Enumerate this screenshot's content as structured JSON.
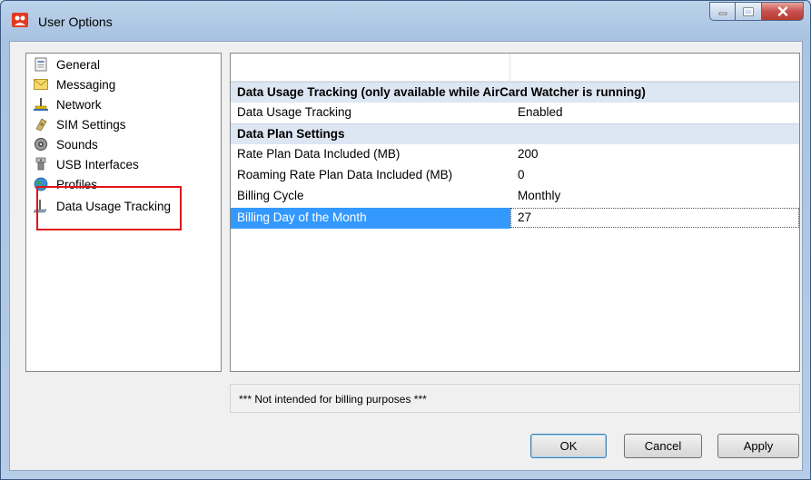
{
  "window": {
    "title": "User Options"
  },
  "nav": {
    "items": [
      {
        "label": "General",
        "icon": "general-icon"
      },
      {
        "label": "Messaging",
        "icon": "envelope-icon"
      },
      {
        "label": "Network",
        "icon": "network-icon"
      },
      {
        "label": "SIM Settings",
        "icon": "sim-card-icon"
      },
      {
        "label": "Sounds",
        "icon": "speaker-icon"
      },
      {
        "label": "USB Interfaces",
        "icon": "usb-icon"
      },
      {
        "label": "Profiles",
        "icon": "globe-icon"
      },
      {
        "label": "Data Usage Tracking",
        "icon": "data-usage-icon"
      }
    ],
    "selected": "Data Usage Tracking"
  },
  "grid": {
    "rows": [
      {
        "type": "category",
        "label": "Data Usage Tracking (only available while AirCard Watcher is running)"
      },
      {
        "type": "property",
        "name": "Data Usage Tracking",
        "value": "Enabled"
      },
      {
        "type": "category",
        "label": "Data Plan Settings"
      },
      {
        "type": "property",
        "name": "Rate Plan Data Included (MB)",
        "value": "200"
      },
      {
        "type": "property",
        "name": "Roaming Rate Plan Data Included (MB)",
        "value": "0"
      },
      {
        "type": "property",
        "name": "Billing Cycle",
        "value": "Monthly"
      },
      {
        "type": "property",
        "name": "Billing Day of the Month",
        "value": "27",
        "selected": true
      }
    ]
  },
  "note": "*** Not intended for billing purposes ***",
  "buttons": {
    "ok": "OK",
    "cancel": "Cancel",
    "apply": "Apply"
  },
  "colors": {
    "selection": "#3399ff",
    "category_bg": "#dde6f3",
    "highlight_box": "#e0141c"
  }
}
